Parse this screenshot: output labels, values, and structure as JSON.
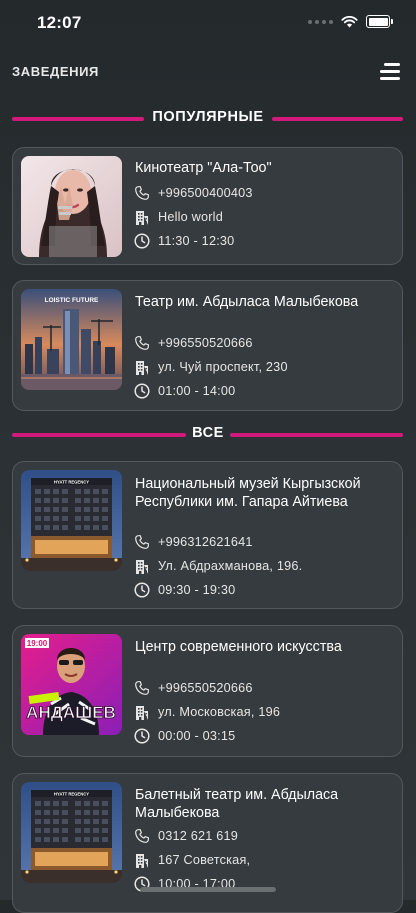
{
  "status_bar": {
    "time": "12:07"
  },
  "header": {
    "title": "ЗАВЕДЕНИЯ"
  },
  "sections": {
    "popular": "ПОПУЛЯРНЫЕ",
    "all": "ВСЕ"
  },
  "accent_color": "#d2197c",
  "popular_venues": [
    {
      "name": "Кинотеатр \"Ала-Тоо\"",
      "phone": "+996500400403",
      "address": "Hello world",
      "hours": "11:30 - 12:30"
    },
    {
      "name": "Театр им. Абдыласа Малыбекова",
      "phone": "+996550520666",
      "address": "ул. Чуй проспект, 230",
      "hours": "01:00 - 14:00",
      "poster_text": "LOISTIC FUTURE"
    }
  ],
  "all_venues": [
    {
      "name": "Национальный музей Кыргызской Республики им. Гапара Айтиева",
      "phone": "+996312621641",
      "address": "Ул. Абдрахманова, 196.",
      "hours": "09:30 - 19:30",
      "sign_text": "HYATT REGENCY"
    },
    {
      "name": "Центр современного искусства",
      "phone": "+996550520666",
      "address": "ул. Московская, 196",
      "hours": "00:00 - 03:15",
      "poster_time": "19:00",
      "poster_name": "АНДАШЕВ"
    },
    {
      "name": "Балетный театр им. Абдыласа Малыбекова",
      "phone": "0312 621 619",
      "address": "167 Советская,",
      "hours": "10:00 - 17:00",
      "sign_text": "HYATT REGENCY"
    }
  ]
}
